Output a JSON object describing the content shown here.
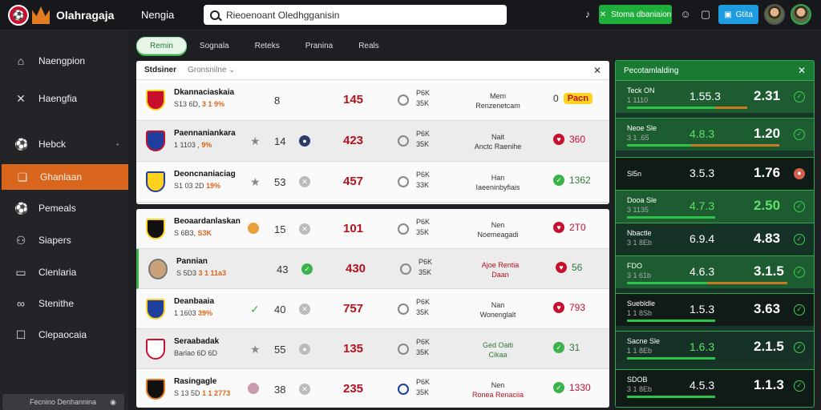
{
  "header": {
    "app_name": "Olahragaja",
    "nav_link": "Nengia",
    "search_placeholder": "Rieoenoant Oledhgganisin",
    "green_button": "Stoma dbaniaion",
    "blue_button": "Gtita"
  },
  "sidebar": {
    "items": [
      {
        "label": "Naengpion",
        "icon": "home-icon"
      },
      {
        "label": "Haengfia",
        "icon": "cross-icon"
      },
      {
        "label": "Hebck",
        "icon": "ball-icon"
      },
      {
        "label": "Ghanlaan",
        "icon": "layers-icon"
      },
      {
        "label": "Pemeals",
        "icon": "ball-icon"
      },
      {
        "label": "Siapers",
        "icon": "users-icon"
      },
      {
        "label": "Clenlaria",
        "icon": "card-icon"
      },
      {
        "label": "Stenithe",
        "icon": "link-icon"
      },
      {
        "label": "Clepaocaia",
        "icon": "chat-icon"
      }
    ],
    "footer": "Fecnino Denhannina"
  },
  "tabs": [
    "Remin",
    "Sognala",
    "Reteks",
    "Pranina",
    "Reals"
  ],
  "panel1": {
    "title": "Stdsiner",
    "select": "Gronsnilne",
    "rows": [
      {
        "team": "Dkannaciaskaia",
        "sub1": "S13 6D,",
        "sub2": "3 1 9%",
        "n1": "8",
        "red": "145",
        "odds1": "P6K",
        "odds2": "35K",
        "note1": "Mem",
        "note2": "Renzenetcam",
        "stat": "0",
        "stat2": "Pacn"
      },
      {
        "team": "Paennaniankara",
        "sub1": "1 1103 ,",
        "sub2": "9%",
        "n1": "14",
        "red": "423",
        "odds1": "P6K",
        "odds2": "35K",
        "note1": "Nait",
        "note2": "Anctc Raenihe",
        "stat": "360"
      },
      {
        "team": "Deoncnaniaciag",
        "sub1": "S1 03 2D",
        "sub2": "19%",
        "n1": "53",
        "red": "457",
        "odds1": "P6K",
        "odds2": "33K",
        "note1": "Han",
        "note2": "Iaeeninbyfiais",
        "stat": "1362"
      }
    ]
  },
  "panel2": {
    "rows": [
      {
        "team": "Beoaardanlaskan",
        "sub1": "S 6B3,",
        "sub2": "S3K",
        "n1": "15",
        "red": "101",
        "odds1": "P6K",
        "odds2": "35K",
        "note1": "Nen",
        "note2": "Noemeagadi",
        "stat": "2T0"
      },
      {
        "team": "Pannian",
        "sub1": "S 5D3",
        "sub2": "3 1 11a3",
        "n1": "43",
        "red": "430",
        "odds1": "P6K",
        "odds2": "35K",
        "note1": "Ajoe Rentia",
        "note2": "Daan",
        "stat": "56"
      },
      {
        "team": "Deanbaaia",
        "sub1": "1 1603",
        "sub2": "39%",
        "n1": "40",
        "red": "757",
        "odds1": "P6K",
        "odds2": "35K",
        "note1": "Nan",
        "note2": "Wonenglalt",
        "stat": "793"
      },
      {
        "team": "Seraabadak",
        "sub1": "Barlao 6D 6D",
        "sub2": "",
        "n1": "55",
        "red": "135",
        "odds1": "P6K",
        "odds2": "35K",
        "note1": "Ged Oaiti",
        "note2": "Cikaa",
        "stat": "31"
      },
      {
        "team": "Rasingagle",
        "sub1": "S 13 5D",
        "sub2": "1 1 2773",
        "n1": "38",
        "red": "235",
        "odds1": "P6K",
        "odds2": "35K",
        "note1": "Nen",
        "note2": "Ronea Renaciia",
        "stat": "1330"
      }
    ]
  },
  "right_panel": {
    "title": "Pecotamlalding",
    "rows": [
      {
        "name": "Teck ON",
        "sub": "1 1110",
        "o1": "1.55.3",
        "o2": "2.31"
      },
      {
        "name": "Neoe Sle",
        "sub": "3 1 .65",
        "o1": "4.8.3",
        "o2": "1.20"
      },
      {
        "name": "Sl5n",
        "sub": "",
        "o1": "3.5.3",
        "o2": "1.76"
      },
      {
        "name": "Dooa Sle",
        "sub": "3 1135",
        "o1": "4.7.3",
        "o2": "2.50"
      },
      {
        "name": "Nbactle",
        "sub": "3 1 8Eb",
        "o1": "6.9.4",
        "o2": "4.83"
      },
      {
        "name": "FDO",
        "sub": "3 1 61b",
        "o1": "4.6.3",
        "o2": "3.1.5"
      },
      {
        "name": "Suebldle",
        "sub": "1 1 8Sb",
        "o1": "1.5.3",
        "o2": "3.63"
      },
      {
        "name": "Sacne Sle",
        "sub": "1 1 8Eb",
        "o1": "1.6.3",
        "o2": "2.1.5"
      },
      {
        "name": "SDOB",
        "sub": "3 1 8Eb",
        "o1": "4.5.3",
        "o2": "1.1.3"
      }
    ]
  }
}
